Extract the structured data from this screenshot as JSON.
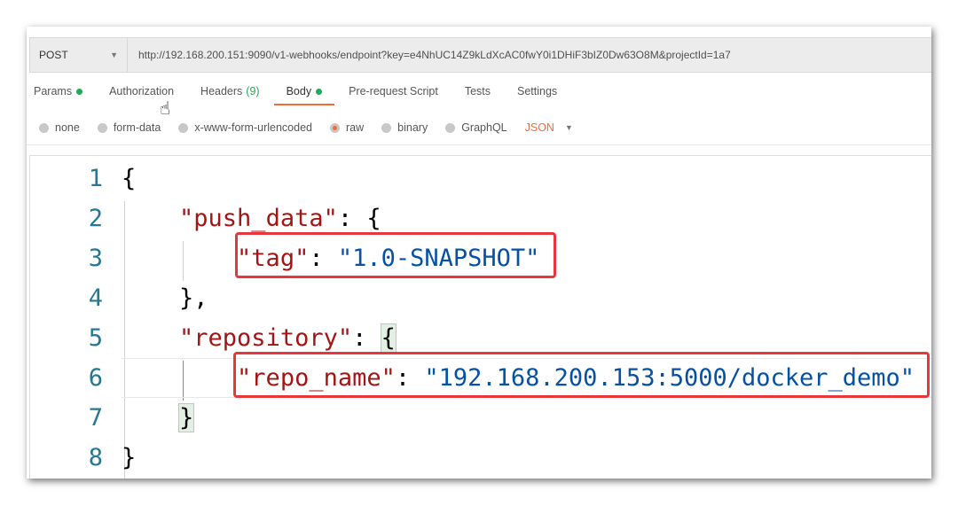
{
  "request": {
    "method": "POST",
    "url": "http://192.168.200.151:9090/v1-webhooks/endpoint?key=e4NhUC14Z9kLdXcAC0fwY0i1DHiF3bIZ0Dw63O8M&projectId=1a7"
  },
  "tabs": [
    {
      "label": "Params",
      "dot": true
    },
    {
      "label": "Authorization"
    },
    {
      "label": "Headers",
      "count": "(9)"
    },
    {
      "label": "Body",
      "dot": true,
      "active": true
    },
    {
      "label": "Pre-request Script"
    },
    {
      "label": "Tests"
    },
    {
      "label": "Settings"
    }
  ],
  "body_modes": [
    "none",
    "form-data",
    "x-www-form-urlencoded",
    "raw",
    "binary",
    "GraphQL"
  ],
  "selected_mode": "raw",
  "format": "JSON",
  "editor": {
    "line_numbers": [
      "1",
      "2",
      "3",
      "4",
      "5",
      "6",
      "7",
      "8"
    ],
    "tokens": {
      "open": "{",
      "push_key": "\"push_data\"",
      "colon_brace": ": {",
      "colon": ": ",
      "tag_key": "\"tag\"",
      "tag_val": "\"1.0-SNAPSHOT\"",
      "close_comma": "},",
      "repo_key": "\"repository\"",
      "brace": "{",
      "repo_name_key": "\"repo_name\"",
      "repo_name_val": "\"192.168.200.153:5000/docker_demo\"",
      "close": "}"
    }
  },
  "colors": {
    "accent": "#f26b3a",
    "key": "#a31515",
    "string": "#0451a5",
    "line_number": "#237893",
    "highlight_box": "#e8373c",
    "status_dot": "#26a65b"
  }
}
